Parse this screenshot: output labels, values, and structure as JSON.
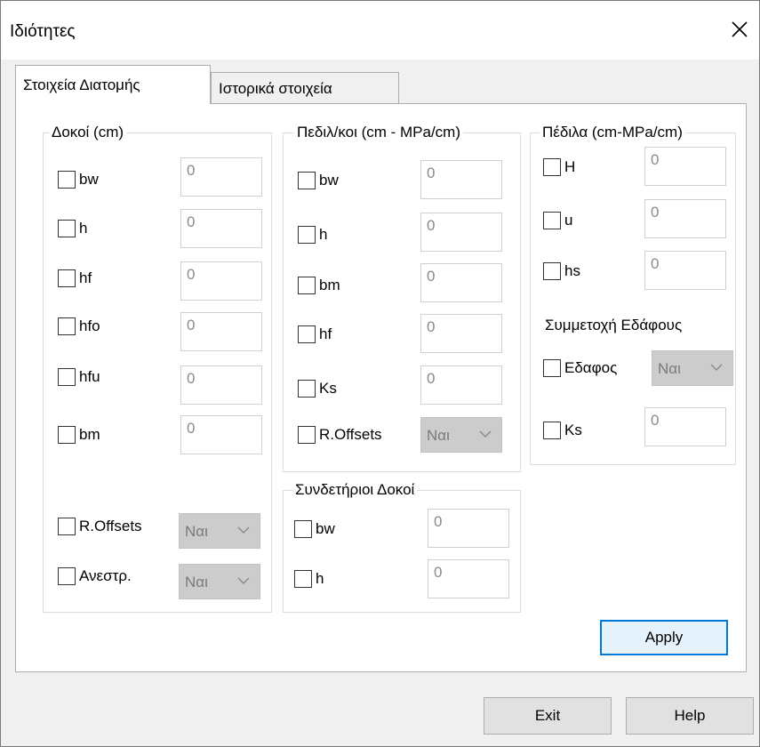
{
  "window": {
    "title": "Ιδιότητες"
  },
  "tabs": [
    {
      "label": "Στοιχεία Διατομής"
    },
    {
      "label": "Ιστορικά στοιχεία"
    }
  ],
  "beams": {
    "legend": "Δοκοί (cm)",
    "rows": [
      {
        "label": "bw",
        "value": "0"
      },
      {
        "label": "h",
        "value": "0"
      },
      {
        "label": "hf",
        "value": "0"
      },
      {
        "label": "hfo",
        "value": "0"
      },
      {
        "label": "hfu",
        "value": "0"
      },
      {
        "label": "bm",
        "value": "0"
      }
    ],
    "offsets": {
      "label": "R.Offsets",
      "value": "Ναι"
    },
    "inverse": {
      "label": "Ανεστρ.",
      "value": "Ναι"
    }
  },
  "strip": {
    "legend": "Πεδιλ/κοι (cm - MPa/cm)",
    "rows": [
      {
        "label": "bw",
        "value": "0"
      },
      {
        "label": "h",
        "value": "0"
      },
      {
        "label": "bm",
        "value": "0"
      },
      {
        "label": "hf",
        "value": "0"
      },
      {
        "label": "Ks",
        "value": "0"
      }
    ],
    "offsets": {
      "label": "R.Offsets",
      "value": "Ναι"
    }
  },
  "tie": {
    "legend": "Συνδετήριοι Δοκοί",
    "rows": [
      {
        "label": "bw",
        "value": "0"
      },
      {
        "label": "h",
        "value": "0"
      }
    ]
  },
  "footing": {
    "legend": "Πέδιλα (cm-MPa/cm)",
    "rows": [
      {
        "label": "H",
        "value": "0"
      },
      {
        "label": "u",
        "value": "0"
      },
      {
        "label": "hs",
        "value": "0"
      }
    ],
    "soil_heading": "Συμμετοχή Εδάφους",
    "soil": {
      "label": "Εδαφος",
      "value": "Ναι"
    },
    "ks": {
      "label": "Ks",
      "value": "0"
    }
  },
  "buttons": {
    "apply": "Apply",
    "exit": "Exit",
    "help": "Help"
  },
  "icons": {
    "close": "close-icon",
    "chevron": "chevron-down-icon"
  }
}
